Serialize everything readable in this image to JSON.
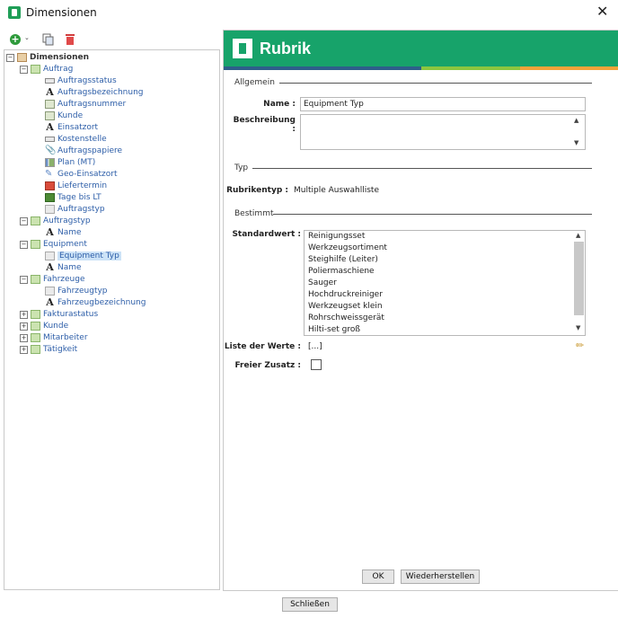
{
  "window": {
    "title": "Dimensionen",
    "close_glyph": "✕"
  },
  "toolbar": {
    "add_glyph": "+",
    "caret_glyph": "⌄"
  },
  "tree": {
    "expander_open": "−",
    "expander_closed": "+",
    "root": "Dimensionen",
    "auftrag": {
      "label": "Auftrag",
      "children": [
        "Auftragsstatus",
        "Auftragsbezeichnung",
        "Auftragsnummer",
        "Kunde",
        "Einsatzort",
        "Kostenstelle",
        "Auftragspapiere",
        "Plan (MT)",
        "Geo-Einsatzort",
        "Liefertermin",
        "Tage bis LT",
        "Auftragstyp"
      ]
    },
    "auftragstyp": {
      "label": "Auftragstyp",
      "children": [
        "Name"
      ]
    },
    "equipment": {
      "label": "Equipment",
      "children": [
        "Equipment Typ",
        "Name"
      ]
    },
    "fahrzeuge": {
      "label": "Fahrzeuge",
      "children": [
        "Fahrzeugtyp",
        "Fahrzeugbezeichnung"
      ]
    },
    "collapsed": [
      "Fakturastatus",
      "Kunde",
      "Mitarbeiter",
      "Tätigkeit"
    ],
    "icons": {
      "text_glyph": "A",
      "clip_glyph": "📎",
      "pen_glyph": "✎"
    }
  },
  "detail": {
    "banner_title": "Rubrik",
    "colors": {
      "banner": "#17a36a",
      "stripe_blue": "#2e5f8a",
      "stripe_green": "#8cc63f",
      "stripe_orange": "#f2a33a"
    },
    "section_allgemein": "Allgemein",
    "section_typ": "Typ",
    "section_bestimmt": "Bestimmt",
    "name_label": "Name :",
    "name_value": "Equipment Typ",
    "beschreibung_label": "Beschreibung :",
    "rubrikentyp_label": "Rubrikentyp :",
    "rubrikentyp_value": "Multiple Auswahlliste",
    "standardwert_label": "Standardwert :",
    "standardwert_options": [
      "Reinigungsset",
      "Werkzeugsortiment",
      "Steighilfe (Leiter)",
      "Poliermaschiene",
      "Sauger",
      "Hochdruckreiniger",
      "Werkzeugset klein",
      "Rohrschweissgerät",
      "Hilti-set groß"
    ],
    "liste_label": "Liste der Werte :",
    "liste_value": "[...]",
    "freier_zusatz_label": "Freier Zusatz :",
    "scroll_up": "▲",
    "scroll_down": "▼",
    "pencil_glyph": "✏",
    "ok_label": "OK",
    "reset_label": "Wiederherstellen"
  },
  "footer": {
    "close_label": "Schließen"
  }
}
